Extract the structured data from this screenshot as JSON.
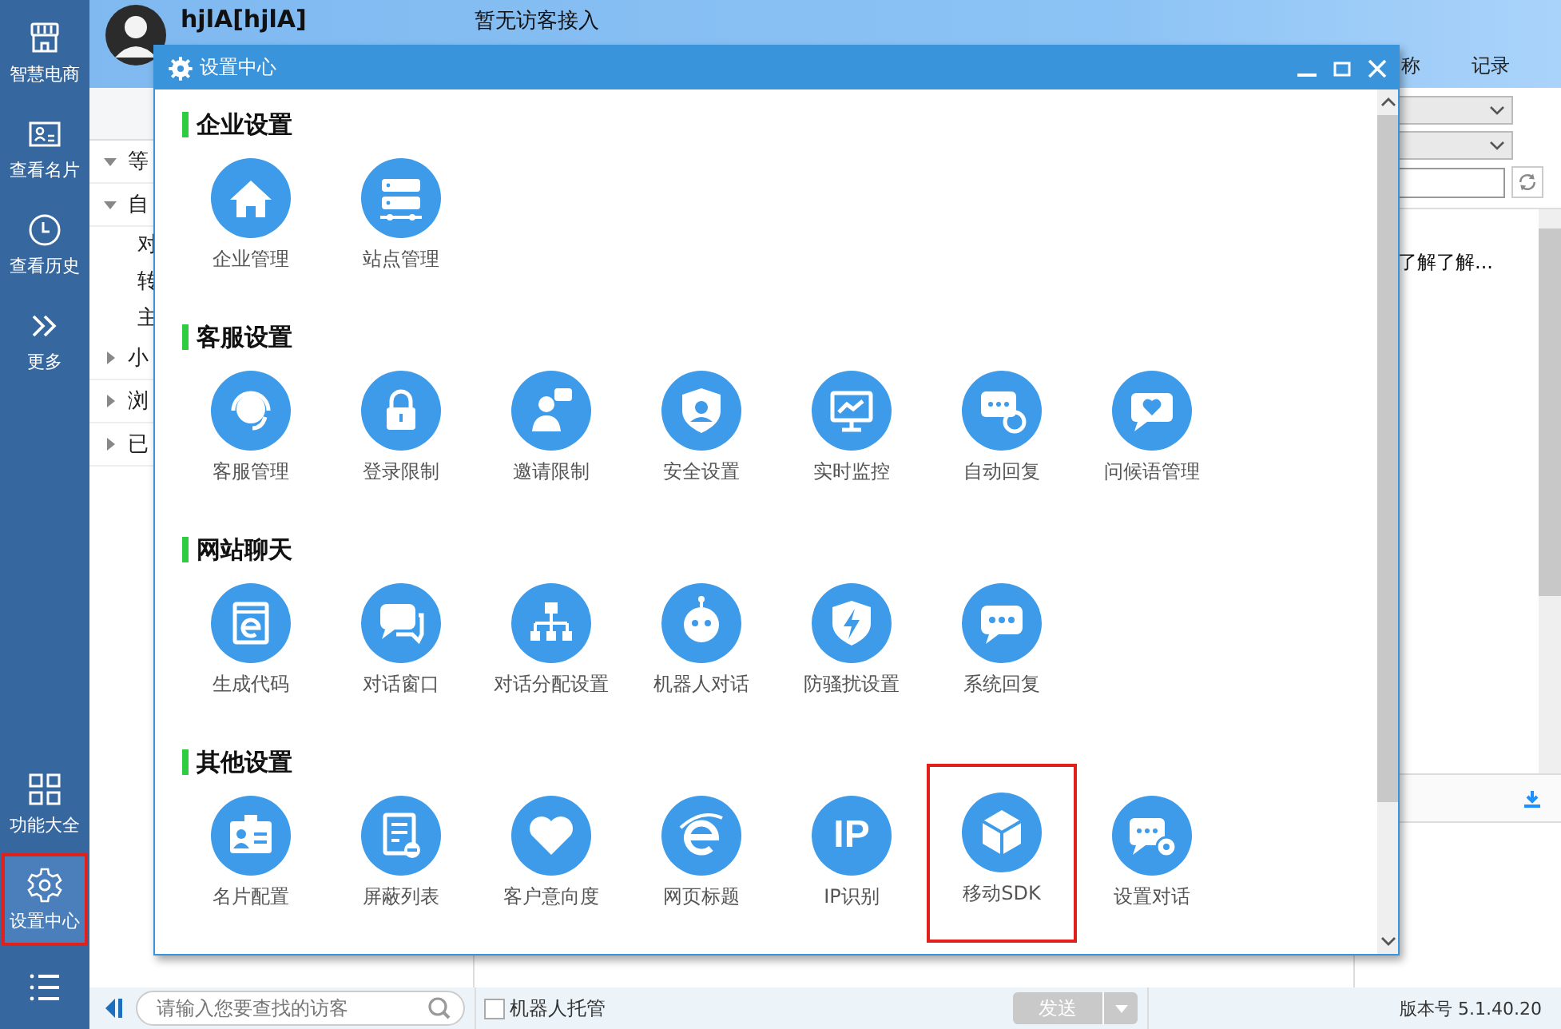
{
  "sidebar": {
    "items": [
      {
        "label": "智慧电商",
        "selected": false,
        "highlighted": false
      },
      {
        "label": "查看名片",
        "selected": false,
        "highlighted": false
      },
      {
        "label": "查看历史",
        "selected": false,
        "highlighted": false
      },
      {
        "label": "更多",
        "selected": false,
        "highlighted": false
      }
    ],
    "bottom_items": [
      {
        "label": "功能大全",
        "selected": false,
        "highlighted": false
      },
      {
        "label": "设置中心",
        "selected": true,
        "highlighted": true
      }
    ]
  },
  "header": {
    "user_name": "hjlA[hjlA]",
    "status": "暂无访客接入",
    "tabs": [
      "称",
      "记录"
    ]
  },
  "visitor_tree": {
    "rows": [
      {
        "label": "等",
        "expanded": true
      },
      {
        "label": "自",
        "expanded": true,
        "children": [
          {
            "label": "对"
          },
          {
            "label": "转"
          },
          {
            "label": "主"
          }
        ]
      },
      {
        "label": "小",
        "expanded": false
      },
      {
        "label": "浏",
        "expanded": false
      },
      {
        "label": "已",
        "expanded": false
      }
    ]
  },
  "right_panel": {
    "message_preview": "了解了解..."
  },
  "footer": {
    "search": {
      "placeholder": "请输入您要查找的访客"
    },
    "robot_hosting": {
      "label": "机器人托管",
      "checked": false
    },
    "send_button": {
      "label": "发送",
      "disabled": true
    },
    "version": "版本号 5.1.40.20"
  },
  "dialog": {
    "title": "设置中心",
    "sections": [
      {
        "title": "企业设置",
        "items": [
          {
            "label": "企业管理",
            "highlighted": false
          },
          {
            "label": "站点管理",
            "highlighted": false
          }
        ]
      },
      {
        "title": "客服设置",
        "items": [
          {
            "label": "客服管理",
            "highlighted": false
          },
          {
            "label": "登录限制",
            "highlighted": false
          },
          {
            "label": "邀请限制",
            "highlighted": false
          },
          {
            "label": "安全设置",
            "highlighted": false
          },
          {
            "label": "实时监控",
            "highlighted": false
          },
          {
            "label": "自动回复",
            "highlighted": false
          },
          {
            "label": "问候语管理",
            "highlighted": false
          }
        ]
      },
      {
        "title": "网站聊天",
        "items": [
          {
            "label": "生成代码",
            "highlighted": false
          },
          {
            "label": "对话窗口",
            "highlighted": false
          },
          {
            "label": "对话分配设置",
            "highlighted": false
          },
          {
            "label": "机器人对话",
            "highlighted": false
          },
          {
            "label": "防骚扰设置",
            "highlighted": false
          },
          {
            "label": "系统回复",
            "highlighted": false
          }
        ]
      },
      {
        "title": "其他设置",
        "items": [
          {
            "label": "名片配置",
            "highlighted": false
          },
          {
            "label": "屏蔽列表",
            "highlighted": false
          },
          {
            "label": "客户意向度",
            "highlighted": false
          },
          {
            "label": "网页标题",
            "highlighted": false
          },
          {
            "label": "IP识别",
            "highlighted": false,
            "icon_text": "IP"
          },
          {
            "label": "移动SDK",
            "highlighted": true
          },
          {
            "label": "设置对话",
            "highlighted": false
          }
        ]
      }
    ]
  }
}
